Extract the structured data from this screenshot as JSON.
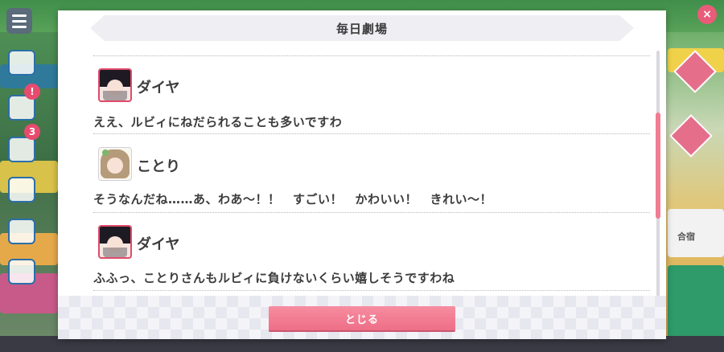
{
  "dialog": {
    "title": "毎日劇場",
    "close_label": "とじる"
  },
  "entries": [
    {
      "speaker": "ダイヤ",
      "avatar": "dia-avatar",
      "text": "ええ、ルビィにねだられることも多いですわ"
    },
    {
      "speaker": "ことり",
      "avatar": "kotori-avatar",
      "text": "そうなんだね……あ、わあ～！！　すごい！　かわいい！　きれい～！"
    },
    {
      "speaker": "ダイヤ",
      "avatar": "dia-avatar",
      "text": "ふふっ、ことりさんもルビィに負けないくらい嬉しそうですわね"
    }
  ],
  "background": {
    "side_badge": "3",
    "right_label": "合宿"
  },
  "colors": {
    "accent": "#ee6f87",
    "title_bar": "#eeeef3",
    "text": "#3c3c3c"
  }
}
